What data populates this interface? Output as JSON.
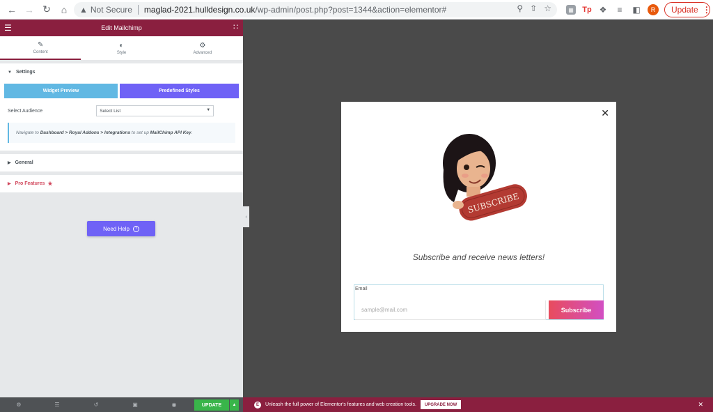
{
  "browser": {
    "security_label": "Not Secure",
    "url_host": "maglad-2021.hulldesign.co.uk",
    "url_path": "/wp-admin/post.php?post=1344&action=elementor#",
    "update_label": "Update",
    "avatar_letter": "R"
  },
  "panel": {
    "title": "Edit Mailchimp",
    "tabs": [
      {
        "label": "Content",
        "icon": "pencil-icon"
      },
      {
        "label": "Style",
        "icon": "half-circle-icon"
      },
      {
        "label": "Advanced",
        "icon": "gear-icon"
      }
    ],
    "settings_label": "Settings",
    "widget_preview_label": "Widget Preview",
    "predefined_styles_label": "Predefined Styles",
    "select_audience_label": "Select Audience",
    "select_audience_value": "Select List",
    "notice_prefix": "Navigate to ",
    "notice_path": "Dashboard > Royal Addons > Integrations",
    "notice_middle": " to set up ",
    "notice_key": "MailChimp API Key",
    "notice_suffix": ".",
    "general_label": "General",
    "pro_features_label": "Pro Features",
    "need_help_label": "Need Help",
    "update_label": "UPDATE"
  },
  "popup": {
    "badge_text": "SUBSCRIBE",
    "tagline": "Subscribe and receive news letters!",
    "email_label": "Email",
    "email_placeholder": "sample@mail.com",
    "subscribe_label": "Subscribe"
  },
  "promo": {
    "text": "Unleash the full power of Elementor's features and web creation tools.",
    "upgrade_label": "UPGRADE NOW"
  },
  "colors": {
    "brand": "#8a1f3f",
    "preview_button": "#61b8e3",
    "styles_button": "#6f62f6",
    "update_green": "#39b54a"
  }
}
